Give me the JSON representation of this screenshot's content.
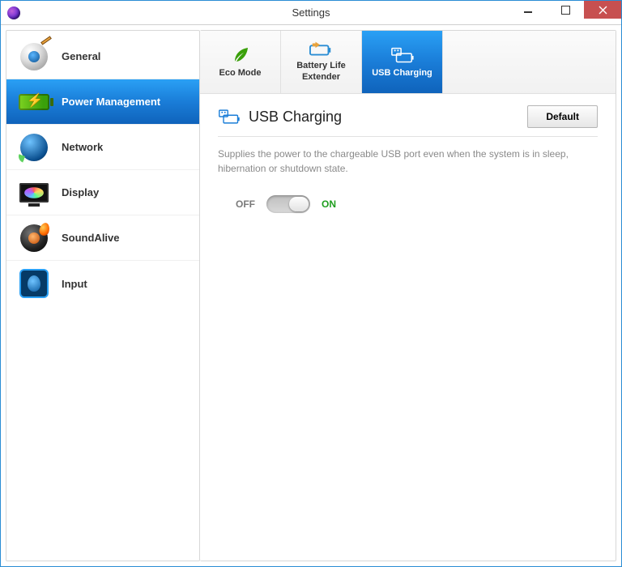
{
  "window": {
    "title": "Settings"
  },
  "sidebar": {
    "items": [
      {
        "label": "General"
      },
      {
        "label": "Power Management"
      },
      {
        "label": "Network"
      },
      {
        "label": "Display"
      },
      {
        "label": "SoundAlive"
      },
      {
        "label": "Input"
      }
    ]
  },
  "tabs": [
    {
      "label": "Eco Mode"
    },
    {
      "label": "Battery Life Extender"
    },
    {
      "label": "USB Charging"
    }
  ],
  "section": {
    "title": "USB Charging",
    "default_btn": "Default",
    "description": "Supplies the power to the chargeable USB port even when the system is in sleep, hibernation or shutdown state."
  },
  "toggle": {
    "off_label": "OFF",
    "on_label": "ON",
    "state": "on"
  }
}
